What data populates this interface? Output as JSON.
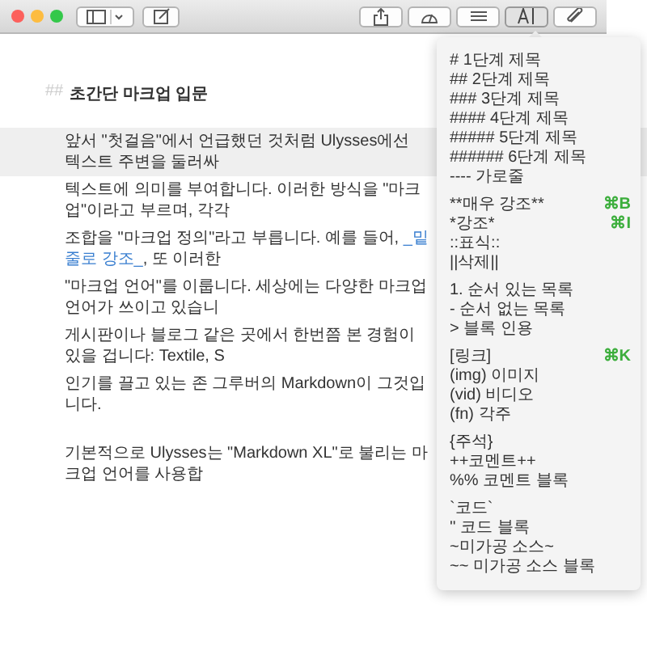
{
  "window": {
    "traffic_lights": [
      {
        "color": "#fc605c"
      },
      {
        "color": "#fdbc40"
      },
      {
        "color": "#34c84a"
      }
    ]
  },
  "toolbar": {
    "left": [
      {
        "kind": "sidebar"
      },
      {
        "kind": "compose"
      }
    ],
    "right": [
      {
        "kind": "share"
      },
      {
        "kind": "gauge"
      },
      {
        "kind": "list"
      },
      {
        "kind": "markup",
        "selected": true
      },
      {
        "kind": "attach"
      }
    ]
  },
  "editor": {
    "heading": {
      "marker": "##",
      "text": "초간단 마크업 입문"
    },
    "paragraphs": [
      [
        {
          "highlighted": true,
          "parts": [
            {
              "kind": "plain",
              "text": "앞서 \"첫걸음\"에서 언급했던 것처럼 Ulysses에선 텍스트 주변을 둘러싸"
            }
          ]
        },
        {
          "highlighted": false,
          "parts": [
            {
              "kind": "plain",
              "text": "텍스트에 의미를 부여합니다. 이러한 방식을 \"마크업\"이라고 부르며, 각각"
            }
          ]
        },
        {
          "highlighted": false,
          "parts": [
            {
              "kind": "plain",
              "text": "조합을 \"마크업 정의\"라고 부릅니다. 예를 들어, "
            },
            {
              "kind": "markup",
              "text": "_밑줄로 강조_"
            },
            {
              "kind": "plain",
              "text": ", 또 이러한"
            }
          ]
        },
        {
          "highlighted": false,
          "parts": [
            {
              "kind": "plain",
              "text": "\"마크업 언어\"를 이룹니다. 세상에는 다양한 마크업 언어가 쓰이고 있습니"
            }
          ]
        },
        {
          "highlighted": false,
          "parts": [
            {
              "kind": "plain",
              "text": "게시판이나 블로그 같은 곳에서 한번쯤 본 경험이 있을 겁니다: Textile, S"
            }
          ]
        },
        {
          "highlighted": false,
          "parts": [
            {
              "kind": "plain",
              "text": "인기를 끌고 있는 존 그루버의 Markdown이 그것입니다."
            }
          ]
        }
      ],
      [
        {
          "highlighted": false,
          "parts": [
            {
              "kind": "plain",
              "text": "기본적으로 Ulysses는 \"Markdown XL\"로 불리는 마크업 언어를 사용합"
            }
          ]
        }
      ]
    ]
  },
  "markup_menu": {
    "groups": [
      [
        {
          "label": "# 1단계 제목"
        },
        {
          "label": "## 2단계 제목"
        },
        {
          "label": "### 3단계 제목"
        },
        {
          "label": "#### 4단계 제목"
        },
        {
          "label": "##### 5단계 제목"
        },
        {
          "label": "###### 6단계 제목"
        },
        {
          "label": "---- 가로줄"
        }
      ],
      [
        {
          "label": "**매우 강조**",
          "shortcut": "⌘B"
        },
        {
          "label": "*강조*",
          "shortcut": "⌘I"
        },
        {
          "label": "::표식::"
        },
        {
          "label": "||삭제||"
        }
      ],
      [
        {
          "label": "1. 순서 있는 목록"
        },
        {
          "label": "- 순서 없는 목록"
        },
        {
          "label": "> 블록 인용"
        }
      ],
      [
        {
          "label": "[링크]",
          "shortcut": "⌘K"
        },
        {
          "label": "(img) 이미지"
        },
        {
          "label": "(vid) 비디오"
        },
        {
          "label": "(fn) 각주"
        }
      ],
      [
        {
          "label": "{주석}"
        },
        {
          "label": "++코멘트++"
        },
        {
          "label": "%% 코멘트 블록"
        }
      ],
      [
        {
          "label": "`코드`"
        },
        {
          "label": "'' 코드 블록"
        },
        {
          "label": "~미가공 소스~"
        },
        {
          "label": "~~ 미가공 소스 블록"
        }
      ]
    ]
  }
}
